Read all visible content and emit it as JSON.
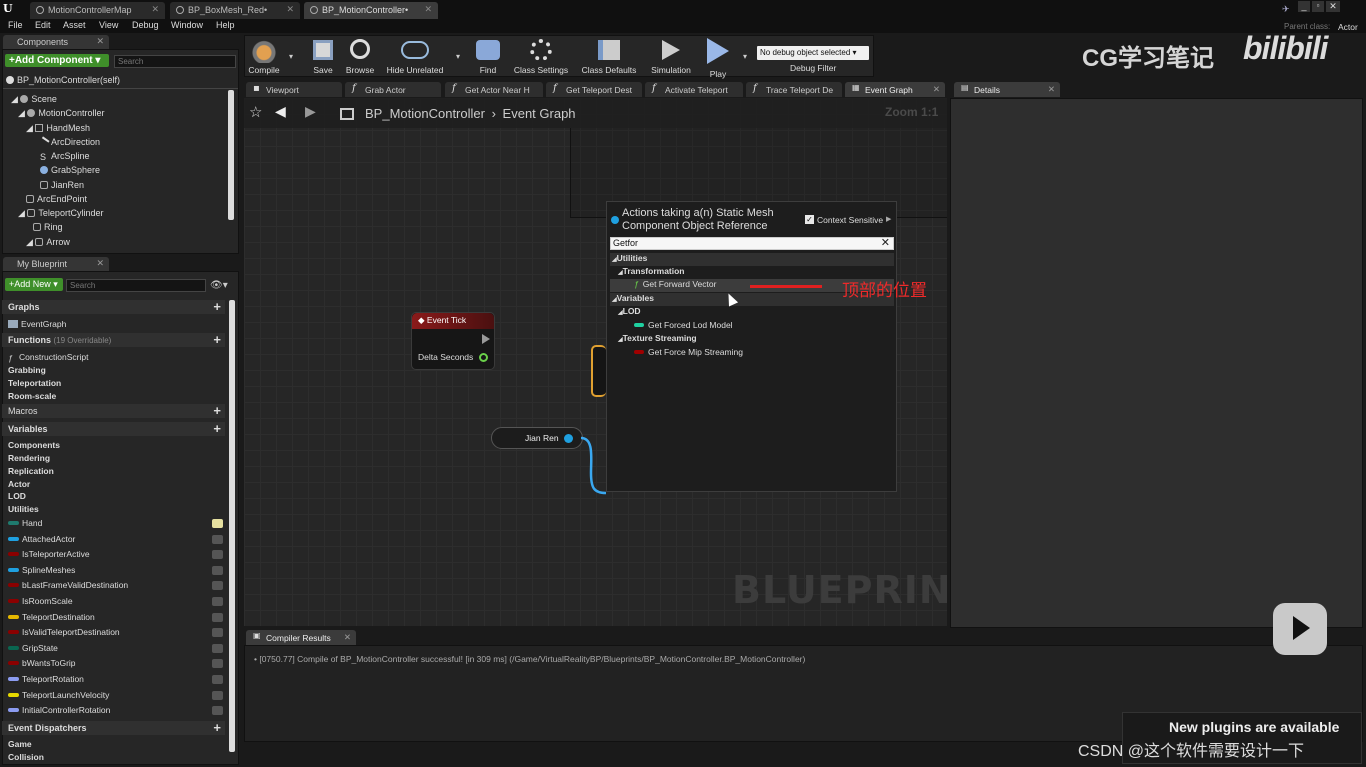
{
  "window": {
    "tabs": [
      {
        "label": "MotionControllerMap"
      },
      {
        "label": "BP_BoxMesh_Red•"
      },
      {
        "label": "BP_MotionController•"
      }
    ],
    "menu": [
      "File",
      "Edit",
      "Asset",
      "View",
      "Debug",
      "Window",
      "Help"
    ],
    "parent_class_label": "Parent class:",
    "parent_class_value": "Actor"
  },
  "components_panel": {
    "tab": "Components",
    "add_component": "+Add Component ▾",
    "search_placeholder": "Search",
    "self": "BP_MotionController(self)",
    "tree": [
      "Scene",
      "MotionController",
      "HandMesh",
      "ArcDirection",
      "ArcSpline",
      "GrabSphere",
      "JianRen",
      "ArcEndPoint",
      "TeleportCylinder",
      "Ring",
      "Arrow"
    ]
  },
  "my_blueprint": {
    "tab": "My Blueprint",
    "add_new": "+Add New ▾",
    "search_placeholder": "Search",
    "graphs_header": "Graphs",
    "event_graph": "EventGraph",
    "functions_header": "Functions",
    "functions_count": "(19 Overridable)",
    "functions": [
      "ConstructionScript",
      "Grabbing",
      "Teleportation",
      "Room-scale"
    ],
    "macros_header": "Macros",
    "variables_header": "Variables",
    "variable_categories": [
      "Components",
      "Rendering",
      "Replication",
      "Actor",
      "LOD",
      "Utilities"
    ],
    "variables": [
      {
        "name": "Hand",
        "color": "#1f7a6e"
      },
      {
        "name": "AttachedActor",
        "color": "#1fa0e0"
      },
      {
        "name": "IsTeleporterActive",
        "color": "#8b0000"
      },
      {
        "name": "SplineMeshes",
        "color": "#1fa0e0"
      },
      {
        "name": "bLastFrameValidDestination",
        "color": "#8b0000"
      },
      {
        "name": "IsRoomScale",
        "color": "#8b0000"
      },
      {
        "name": "TeleportDestination",
        "color": "#e6b800"
      },
      {
        "name": "IsValidTeleportDestination",
        "color": "#8b0000"
      },
      {
        "name": "GripState",
        "color": "#0a6650"
      },
      {
        "name": "bWantsToGrip",
        "color": "#8b0000"
      },
      {
        "name": "TeleportRotation",
        "color": "#8c9cf0"
      },
      {
        "name": "TeleportLaunchVelocity",
        "color": "#e6d800"
      },
      {
        "name": "InitialControllerRotation",
        "color": "#8c9cf0"
      }
    ],
    "dispatchers_header": "Event Dispatchers",
    "dispatcher_categories": [
      "Game",
      "Collision"
    ]
  },
  "toolbar": {
    "buttons": [
      "Compile",
      "Save",
      "Browse",
      "Hide Unrelated",
      "Find",
      "Class Settings",
      "Class Defaults",
      "Simulation",
      "Play"
    ],
    "debug_select": "No debug object selected ▾",
    "debug_filter": "Debug Filter"
  },
  "editor_tabs": [
    "Viewport",
    "Grab Actor",
    "Get Actor Near H",
    "Get Teleport Dest",
    "Activate Teleport",
    "Trace Teleport De",
    "Event Graph"
  ],
  "details_tab": "Details",
  "graph": {
    "breadcrumb_root": "BP_MotionController",
    "breadcrumb_sep": "›",
    "breadcrumb_leaf": "Event Graph",
    "zoom": "Zoom 1:1",
    "watermark": "BLUEPRINT",
    "event_tick_title": "Event Tick",
    "delta_seconds": "Delta Seconds",
    "jian_ren": "Jian Ren"
  },
  "context_menu": {
    "title_line1": "Actions taking a(n) Static Mesh",
    "title_line2": "Component Object Reference",
    "context_sensitive": "Context Sensitive",
    "search_value": "Getfor",
    "rows": [
      {
        "label": "Utilities",
        "level": 0
      },
      {
        "label": "Transformation",
        "level": 1
      },
      {
        "label": "Get Forward Vector",
        "level": 2
      },
      {
        "label": "Variables",
        "level": 0
      },
      {
        "label": "LOD",
        "level": 1
      },
      {
        "label": "Get Forced Lod Model",
        "level": 2
      },
      {
        "label": "Texture Streaming",
        "level": 1
      },
      {
        "label": "Get Force Mip Streaming",
        "level": 2
      }
    ]
  },
  "annotation": "顶部的位置",
  "compiler": {
    "tab": "Compiler Results",
    "message": "[0750.77] Compile of BP_MotionController successful! [in 309 ms] (/Game/VirtualRealityBP/Blueprints/BP_MotionController.BP_MotionController)"
  },
  "notification": "New plugins are available",
  "overlay": {
    "watermark_left": "CG学习笔记",
    "watermark_right": "bilibili",
    "csdn": "CSDN @这个软件需要设计一下"
  }
}
